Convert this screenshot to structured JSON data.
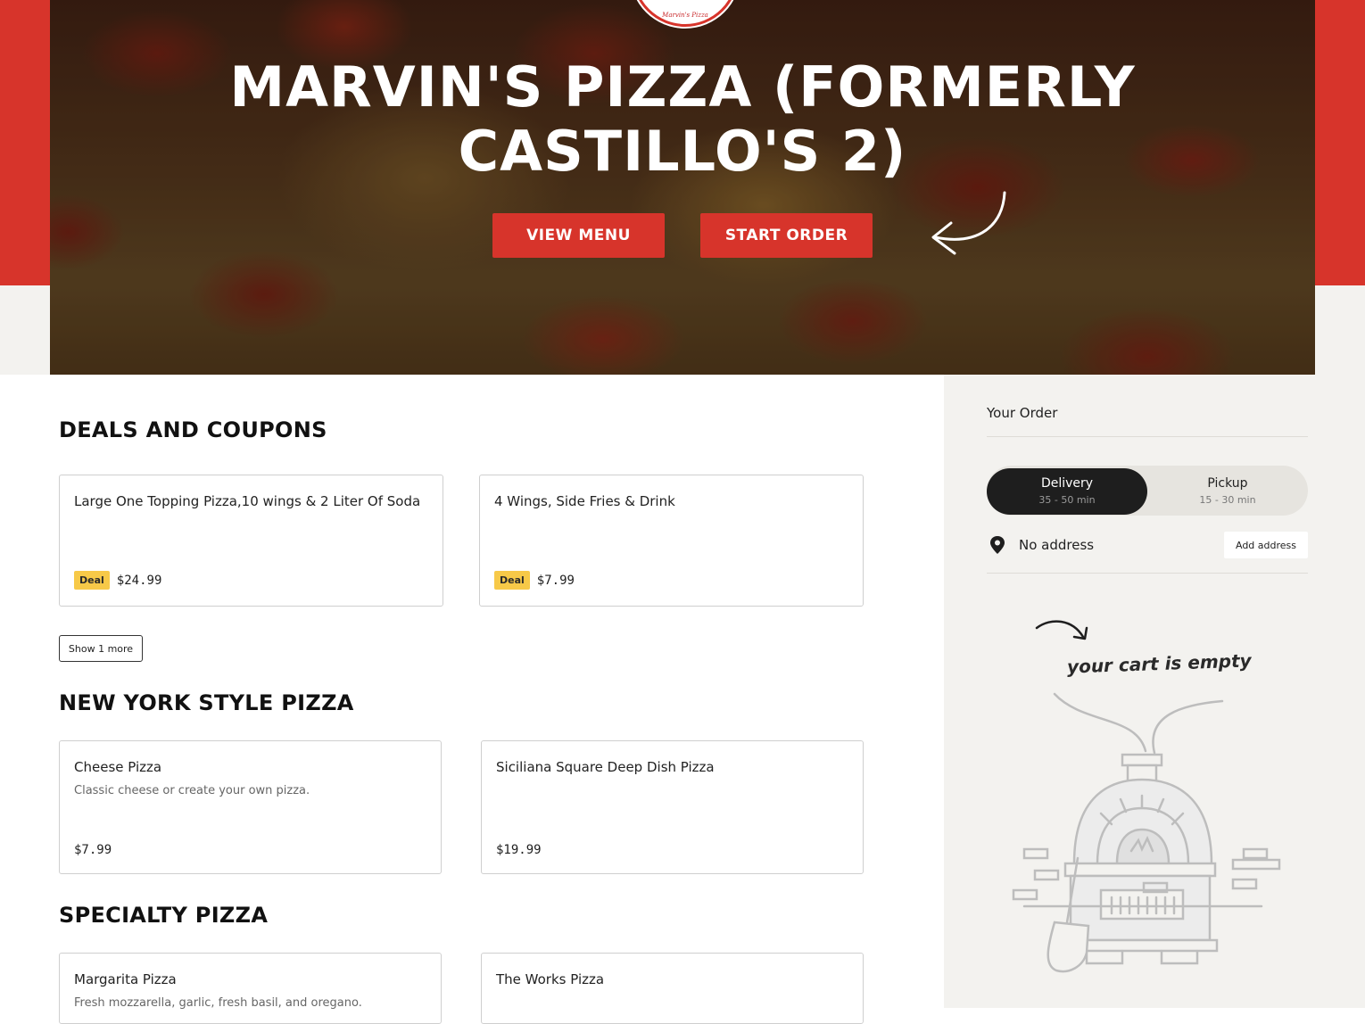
{
  "hero": {
    "logo_text": "Marvin's Pizza",
    "title": "MARVIN'S PIZZA (FORMERLY CASTILLO'S 2)",
    "view_menu_label": "VIEW MENU",
    "start_order_label": "START ORDER"
  },
  "sections": {
    "deals": {
      "title": "DEALS AND COUPONS",
      "items": [
        {
          "name": "Large One Topping Pizza,10 wings & 2 Liter Of Soda",
          "badge": "Deal",
          "price": "$24.99"
        },
        {
          "name": "4 Wings, Side Fries & Drink",
          "badge": "Deal",
          "price": "$7.99"
        }
      ],
      "show_more_label": "Show 1 more"
    },
    "ny": {
      "title": "NEW YORK STYLE PIZZA",
      "items": [
        {
          "name": "Cheese Pizza",
          "description": "Classic cheese or create your own pizza.",
          "price": "$7.99"
        },
        {
          "name": "Siciliana Square Deep Dish Pizza",
          "description": "",
          "price": "$19.99"
        }
      ]
    },
    "specialty": {
      "title": "SPECIALTY PIZZA",
      "items": [
        {
          "name": "Margarita Pizza",
          "description": "Fresh mozzarella, garlic, fresh basil, and oregano."
        },
        {
          "name": "The Works Pizza",
          "description": ""
        }
      ]
    }
  },
  "order": {
    "title": "Your Order",
    "delivery": {
      "label": "Delivery",
      "time": "35 - 50 min"
    },
    "pickup": {
      "label": "Pickup",
      "time": "15 - 30 min"
    },
    "address_text": "No address",
    "add_address_label": "Add address",
    "empty_text": "your cart is empty"
  },
  "colors": {
    "brand_red": "#d7342b",
    "deal_yellow": "#f7c948",
    "sidebar_bg": "#f3f2ef",
    "toggle_active": "#1e1e1e"
  },
  "icons": {
    "pin": "location-pin-icon",
    "hero_arrow": "curved-arrow-icon",
    "cart_arrow": "curved-arrow-icon",
    "oven": "pizza-oven-illustration"
  }
}
